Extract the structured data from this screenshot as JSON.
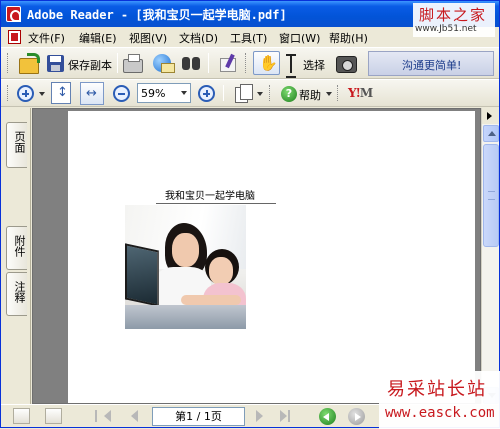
{
  "window": {
    "title": "Adobe Reader - [我和宝贝一起学电脑.pdf]"
  },
  "menu": {
    "items": [
      {
        "label": "文件(F)"
      },
      {
        "label": "编辑(E)"
      },
      {
        "label": "视图(V)"
      },
      {
        "label": "文档(D)"
      },
      {
        "label": "工具(T)"
      },
      {
        "label": "窗口(W)"
      },
      {
        "label": "帮助(H)"
      }
    ]
  },
  "toolbar1": {
    "save_copy_label": "保存副本",
    "select_label": "选择",
    "promo_label": "沟通更简单!"
  },
  "toolbar2": {
    "zoom_value": "59%",
    "help_label": "帮助",
    "yahoo_label_y": "Y!",
    "yahoo_label_m": "M"
  },
  "side_tabs": {
    "pages": "页面",
    "attachments": "附件",
    "comments": "注释"
  },
  "document": {
    "heading": "我和宝贝一起学电脑"
  },
  "statusbar": {
    "page_indicator": "第1 / 1页"
  },
  "watermarks": {
    "top_cn": "脚本之家",
    "top_url": "www.Jb51.net",
    "bottom_cn": "易采站长站",
    "bottom_url": "www.easck.com"
  },
  "icons": {
    "open": "open-folder-icon",
    "save": "floppy-disk-icon",
    "print": "printer-icon",
    "email": "email-icon",
    "search": "binoculars-icon",
    "sign": "sign-icon",
    "hand": "hand-tool-icon",
    "select": "text-select-icon",
    "snapshot": "camera-icon"
  },
  "colors": {
    "titlebar": "#0254d8",
    "accent_red": "#c8191e",
    "promo_text": "#1b3b8b"
  }
}
